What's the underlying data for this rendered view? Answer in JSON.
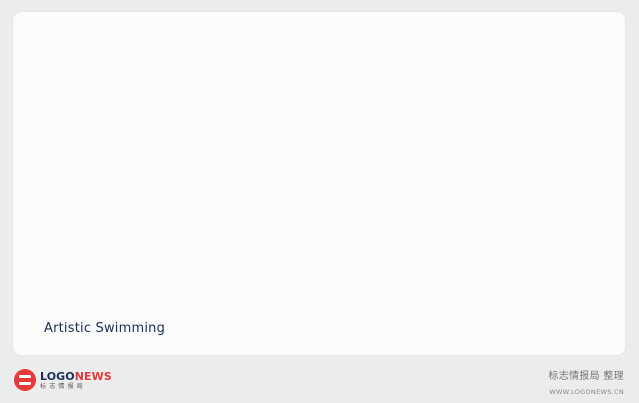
{
  "card": {
    "caption": "Artistic Swimming"
  },
  "footer": {
    "logo": {
      "word_part1": "LOGO",
      "word_part2": "NEWS",
      "subtitle": "标志情报局",
      "icon": "logonews-icon"
    },
    "credit": "标志情报局  整理",
    "site": "WWW.LOGONEWS.CN"
  },
  "colors": {
    "background": "#ececec",
    "card": "#fbfbfb",
    "caption": "#1a2f57",
    "brand_red": "#e6393a"
  }
}
